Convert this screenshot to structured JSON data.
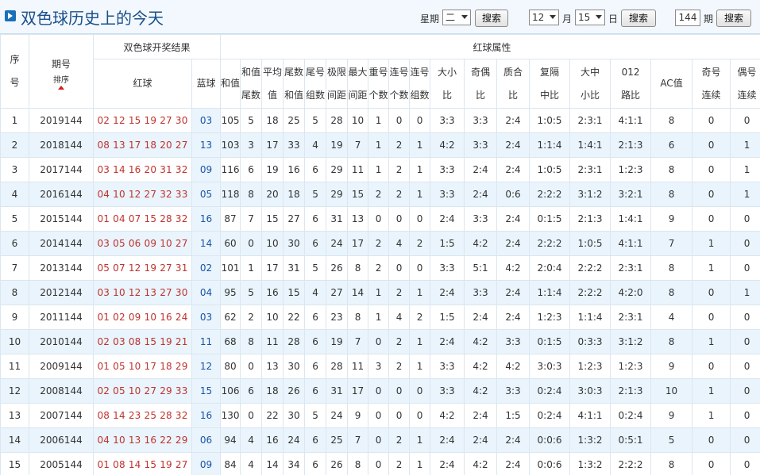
{
  "header": {
    "title": "双色球历史上的今天",
    "weekday_label": "星期",
    "weekday_value": "二",
    "search1": "搜索",
    "month_value": "12",
    "month_label": "月",
    "day_value": "15",
    "day_label": "日",
    "search2": "搜索",
    "period_value": "144",
    "period_label": "期",
    "search3": "搜索"
  },
  "table": {
    "h_seq": [
      "序",
      "号"
    ],
    "h_period": "期号",
    "h_sort": "排序",
    "h_group_result": "双色球开奖结果",
    "h_group_attr": "红球属性",
    "h_red": "红球",
    "h_blue": "蓝球",
    "h_sum": "和值",
    "h_cols": [
      [
        "和值",
        "尾数"
      ],
      [
        "平均",
        "值"
      ],
      [
        "尾数",
        "和值"
      ],
      [
        "尾号",
        "组数"
      ],
      [
        "极限",
        "间距"
      ],
      [
        "最大",
        "间距"
      ],
      [
        "重号",
        "个数"
      ],
      [
        "连号",
        "个数"
      ],
      [
        "连号",
        "组数"
      ],
      [
        "大小",
        "比"
      ],
      [
        "奇偶",
        "比"
      ],
      [
        "质合",
        "比"
      ],
      [
        "复隔",
        "中比"
      ],
      [
        "大中",
        "小比"
      ],
      [
        "012",
        "路比"
      ]
    ],
    "h_ac": "AC值",
    "h_odd": [
      "奇号",
      "连续"
    ],
    "h_even": [
      "偶号",
      "连续"
    ],
    "rows": [
      [
        "1",
        "2019144",
        "02 12 15 19 27 30",
        "03",
        "105",
        "5",
        "18",
        "25",
        "5",
        "28",
        "10",
        "1",
        "0",
        "0",
        "3:3",
        "3:3",
        "2:4",
        "1:0:5",
        "2:3:1",
        "4:1:1",
        "8",
        "0",
        "0"
      ],
      [
        "2",
        "2018144",
        "08 13 17 18 20 27",
        "13",
        "103",
        "3",
        "17",
        "33",
        "4",
        "19",
        "7",
        "1",
        "2",
        "1",
        "4:2",
        "3:3",
        "2:4",
        "1:1:4",
        "1:4:1",
        "2:1:3",
        "6",
        "0",
        "1"
      ],
      [
        "3",
        "2017144",
        "03 14 16 20 31 32",
        "09",
        "116",
        "6",
        "19",
        "16",
        "6",
        "29",
        "11",
        "1",
        "2",
        "1",
        "3:3",
        "2:4",
        "2:4",
        "1:0:5",
        "2:3:1",
        "1:2:3",
        "8",
        "0",
        "1"
      ],
      [
        "4",
        "2016144",
        "04 10 12 27 32 33",
        "05",
        "118",
        "8",
        "20",
        "18",
        "5",
        "29",
        "15",
        "2",
        "2",
        "1",
        "3:3",
        "2:4",
        "0:6",
        "2:2:2",
        "3:1:2",
        "3:2:1",
        "8",
        "0",
        "1"
      ],
      [
        "5",
        "2015144",
        "01 04 07 15 28 32",
        "16",
        "87",
        "7",
        "15",
        "27",
        "6",
        "31",
        "13",
        "0",
        "0",
        "0",
        "2:4",
        "3:3",
        "2:4",
        "0:1:5",
        "2:1:3",
        "1:4:1",
        "9",
        "0",
        "0"
      ],
      [
        "6",
        "2014144",
        "03 05 06 09 10 27",
        "14",
        "60",
        "0",
        "10",
        "30",
        "6",
        "24",
        "17",
        "2",
        "4",
        "2",
        "1:5",
        "4:2",
        "2:4",
        "2:2:2",
        "1:0:5",
        "4:1:1",
        "7",
        "1",
        "0"
      ],
      [
        "7",
        "2013144",
        "05 07 12 19 27 31",
        "02",
        "101",
        "1",
        "17",
        "31",
        "5",
        "26",
        "8",
        "2",
        "0",
        "0",
        "3:3",
        "5:1",
        "4:2",
        "2:0:4",
        "2:2:2",
        "2:3:1",
        "8",
        "1",
        "0"
      ],
      [
        "8",
        "2012144",
        "03 10 12 13 27 30",
        "04",
        "95",
        "5",
        "16",
        "15",
        "4",
        "27",
        "14",
        "1",
        "2",
        "1",
        "2:4",
        "3:3",
        "2:4",
        "1:1:4",
        "2:2:2",
        "4:2:0",
        "8",
        "0",
        "1"
      ],
      [
        "9",
        "2011144",
        "01 02 09 10 16 24",
        "03",
        "62",
        "2",
        "10",
        "22",
        "6",
        "23",
        "8",
        "1",
        "4",
        "2",
        "1:5",
        "2:4",
        "2:4",
        "1:2:3",
        "1:1:4",
        "2:3:1",
        "4",
        "0",
        "0"
      ],
      [
        "10",
        "2010144",
        "02 03 08 15 19 21",
        "11",
        "68",
        "8",
        "11",
        "28",
        "6",
        "19",
        "7",
        "0",
        "2",
        "1",
        "2:4",
        "4:2",
        "3:3",
        "0:1:5",
        "0:3:3",
        "3:1:2",
        "8",
        "1",
        "0"
      ],
      [
        "11",
        "2009144",
        "01 05 10 17 18 29",
        "12",
        "80",
        "0",
        "13",
        "30",
        "6",
        "28",
        "11",
        "3",
        "2",
        "1",
        "3:3",
        "4:2",
        "4:2",
        "3:0:3",
        "1:2:3",
        "1:2:3",
        "9",
        "0",
        "0"
      ],
      [
        "12",
        "2008144",
        "02 05 10 27 29 33",
        "15",
        "106",
        "6",
        "18",
        "26",
        "6",
        "31",
        "17",
        "0",
        "0",
        "0",
        "3:3",
        "4:2",
        "3:3",
        "0:2:4",
        "3:0:3",
        "2:1:3",
        "10",
        "1",
        "0"
      ],
      [
        "13",
        "2007144",
        "08 14 23 25 28 32",
        "16",
        "130",
        "0",
        "22",
        "30",
        "5",
        "24",
        "9",
        "0",
        "0",
        "0",
        "4:2",
        "2:4",
        "1:5",
        "0:2:4",
        "4:1:1",
        "0:2:4",
        "9",
        "1",
        "0"
      ],
      [
        "14",
        "2006144",
        "04 10 13 16 22 29",
        "06",
        "94",
        "4",
        "16",
        "24",
        "6",
        "25",
        "7",
        "0",
        "2",
        "1",
        "2:4",
        "2:4",
        "2:4",
        "0:0:6",
        "1:3:2",
        "0:5:1",
        "5",
        "0",
        "0"
      ],
      [
        "15",
        "2005144",
        "01 08 14 15 19 27",
        "09",
        "84",
        "4",
        "14",
        "34",
        "6",
        "26",
        "8",
        "0",
        "2",
        "1",
        "2:4",
        "4:2",
        "2:4",
        "0:0:6",
        "1:3:2",
        "2:2:2",
        "8",
        "0",
        "0"
      ]
    ]
  }
}
